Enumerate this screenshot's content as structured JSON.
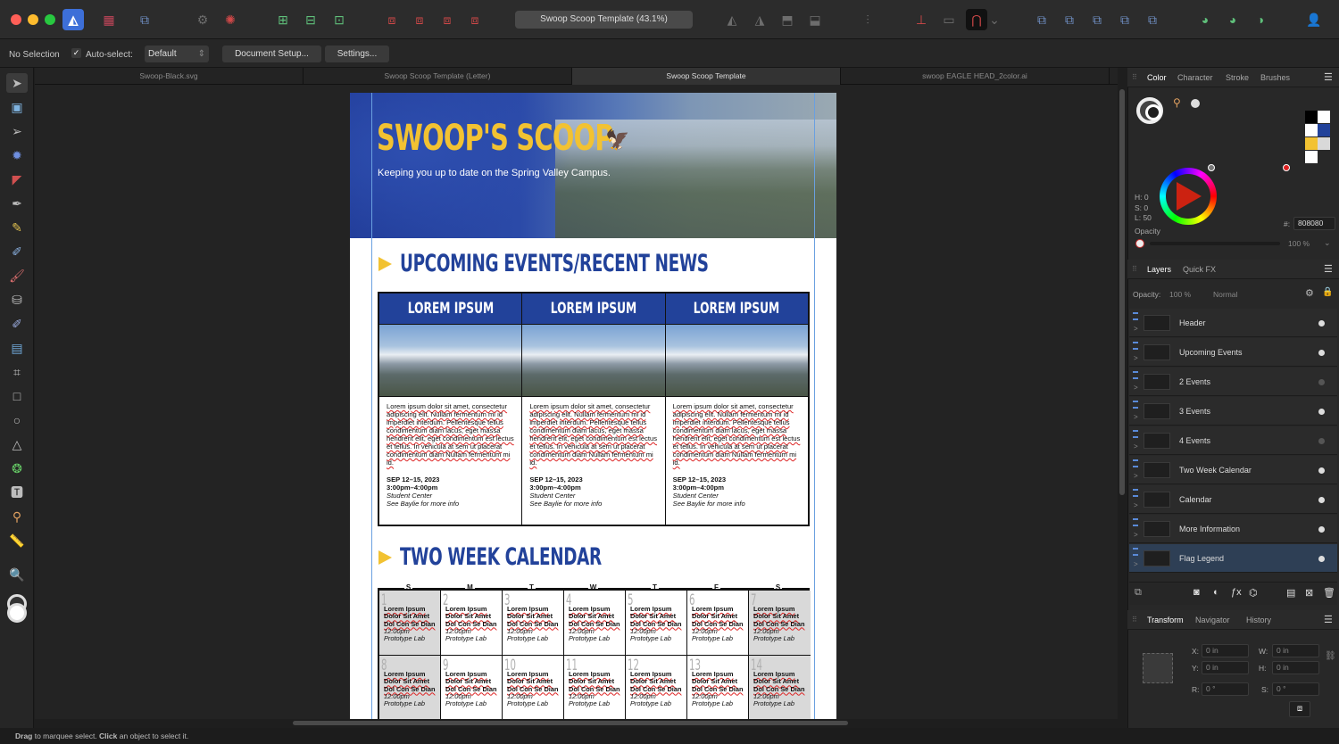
{
  "toolbar": {
    "document_title": "Swoop Scoop Template (43.1%)"
  },
  "context_bar": {
    "selection": "No Selection",
    "auto_select_label": "Auto-select:",
    "auto_select_checked": true,
    "auto_select_value": "Default",
    "document_setup_button": "Document Setup...",
    "settings_button": "Settings..."
  },
  "tabs": [
    {
      "label": "Swoop-Black.svg",
      "active": false
    },
    {
      "label": "Swoop Scoop Template (Letter)",
      "active": false
    },
    {
      "label": "Swoop Scoop Template",
      "active": true
    },
    {
      "label": "swoop EAGLE HEAD_2color.ai",
      "active": false
    }
  ],
  "page": {
    "title": "SWOOP'S SCOOP",
    "subtitle": "Keeping you up to date on the Spring Valley Campus.",
    "section1": "UPCOMING EVENTS/RECENT NEWS",
    "section2": "TWO WEEK CALENDAR",
    "cards": [
      {
        "header": "LOREM IPSUM",
        "body": "Lorem ipsum dolor sit amet, consectetur adipiscing elit. Nullam fermentum mi id imperdiet interdum. Pellentesque tellus condimentum diam lacus, eget massa hendrerit elit, eget condimentum est lectus et tellus. In vehicula at sem ut placerat condimentum diam Nullam fermentum mi id.",
        "date": "SEP 12–15, 2023",
        "time": "3:00pm–4:00pm",
        "location": "Student Center",
        "info": "See Baylie for more info"
      },
      {
        "header": "LOREM IPSUM",
        "body": "Lorem ipsum dolor sit amet, consectetur adipiscing elit. Nullam fermentum mi id imperdiet interdum. Pellentesque tellus condimentum diam lacus, eget massa hendrerit elit, eget condimentum est lectus et tellus. In vehicula at sem ut placerat condimentum diam Nullam fermentum mi id.",
        "date": "SEP 12–15, 2023",
        "time": "3:00pm–4:00pm",
        "location": "Student Center",
        "info": "See Baylie for more info"
      },
      {
        "header": "LOREM IPSUM",
        "body": "Lorem ipsum dolor sit amet, consectetur adipiscing elit. Nullam fermentum mi id imperdiet interdum. Pellentesque tellus condimentum diam lacus, eget massa hendrerit elit, eget condimentum est lectus et tellus. In vehicula at sem ut placerat condimentum diam Nullam fermentum mi id.",
        "date": "SEP 12–15, 2023",
        "time": "3:00pm–4:00pm",
        "location": "Student Center",
        "info": "See Baylie for more info"
      }
    ],
    "calendar": {
      "days": [
        "S",
        "M",
        "T",
        "W",
        "T",
        "F",
        "S"
      ],
      "event_title": "Lorem Ipsum Dolor Sit Amet Dol Con Se Dian",
      "event_time": "12:00pm",
      "event_place": "Prototype Lab",
      "dates": [
        "1",
        "2",
        "3",
        "4",
        "5",
        "6",
        "7",
        "8",
        "9",
        "10",
        "11",
        "12",
        "13",
        "14"
      ]
    }
  },
  "color_panel": {
    "tabs": [
      "Color",
      "Character",
      "Stroke",
      "Brushes"
    ],
    "active_tab": "Color",
    "h": "H: 0",
    "s": "S: 0",
    "l": "L: 50",
    "opacity_label": "Opacity",
    "opacity_value": "100 %",
    "hex_label": "#:",
    "hex_value": "808080",
    "swatches": [
      "#000000",
      "#ffffff",
      "#ffffff",
      "#22429a",
      "#f2c232",
      "#d9d9d9",
      "#ffffff"
    ]
  },
  "layers_panel": {
    "tabs": [
      "Layers",
      "Quick FX"
    ],
    "active_tab": "Layers",
    "opacity_label": "Opacity:",
    "opacity_value": "100 %",
    "blend_mode": "Normal",
    "layers": [
      {
        "name": "Header",
        "visible": true,
        "selected": false
      },
      {
        "name": "Upcoming Events",
        "visible": true,
        "selected": false
      },
      {
        "name": "2 Events",
        "visible": false,
        "selected": false
      },
      {
        "name": "3 Events",
        "visible": true,
        "selected": false
      },
      {
        "name": "4 Events",
        "visible": false,
        "selected": false
      },
      {
        "name": "Two Week Calendar",
        "visible": true,
        "selected": false
      },
      {
        "name": "Calendar",
        "visible": true,
        "selected": false
      },
      {
        "name": "More Information",
        "visible": true,
        "selected": false
      },
      {
        "name": "Flag Legend",
        "visible": true,
        "selected": true
      }
    ]
  },
  "transform_panel": {
    "tabs": [
      "Transform",
      "Navigator",
      "History"
    ],
    "active_tab": "Transform",
    "x_label": "X:",
    "x_value": "0 in",
    "y_label": "Y:",
    "y_value": "0 in",
    "w_label": "W:",
    "w_value": "0 in",
    "h_label": "H:",
    "h_value": "0 in",
    "r_label": "R:",
    "r_value": "0 °",
    "s_label": "S:",
    "s_value": "0 °"
  },
  "status": {
    "drag": "Drag",
    "drag_text": " to marquee select. ",
    "click": "Click",
    "click_text": " an object to select it."
  }
}
